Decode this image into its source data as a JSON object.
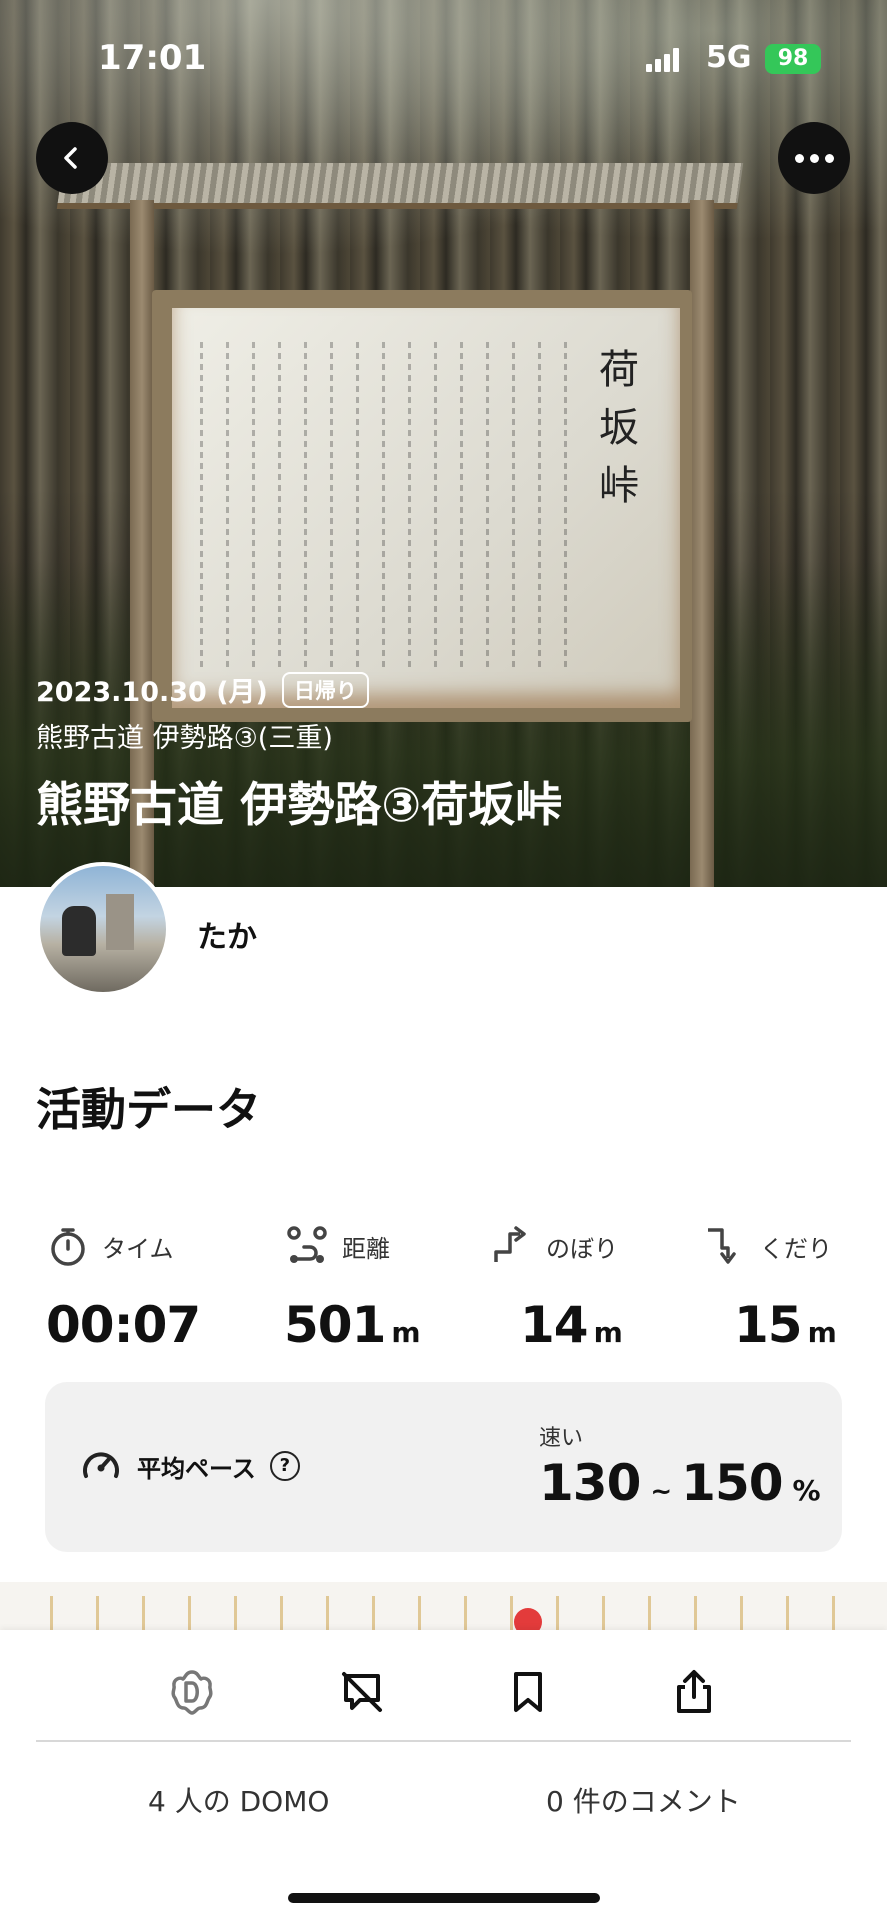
{
  "status_bar": {
    "time": "17:01",
    "network": "5G",
    "battery": "98"
  },
  "hero": {
    "date": "2023.10.30 (月)",
    "trip_type": "日帰り",
    "area": "熊野古道 伊勢路③(三重)",
    "title": "熊野古道 伊勢路③荷坂峠",
    "sign_heading": "荷坂峠"
  },
  "user": {
    "name": "たか"
  },
  "activity": {
    "section_title": "活動データ",
    "stats": [
      {
        "label": "タイム",
        "value": "00:07",
        "unit": "",
        "icon": "stopwatch-icon"
      },
      {
        "label": "距離",
        "value": "501",
        "unit": "m",
        "icon": "route-icon"
      },
      {
        "label": "のぼり",
        "value": "14",
        "unit": "m",
        "icon": "ascent-icon"
      },
      {
        "label": "くだり",
        "value": "15",
        "unit": "m",
        "icon": "descent-icon"
      }
    ],
    "pace": {
      "label": "平均ペース",
      "help": "?",
      "speed_label": "速い",
      "min": "130",
      "separator": "~",
      "max": "150",
      "unit": "%"
    }
  },
  "actions": {
    "domo_count": "4 人の DOMO",
    "comment_count": "0 件のコメント"
  },
  "colors": {
    "battery": "#34c759",
    "accent": "#111111"
  }
}
